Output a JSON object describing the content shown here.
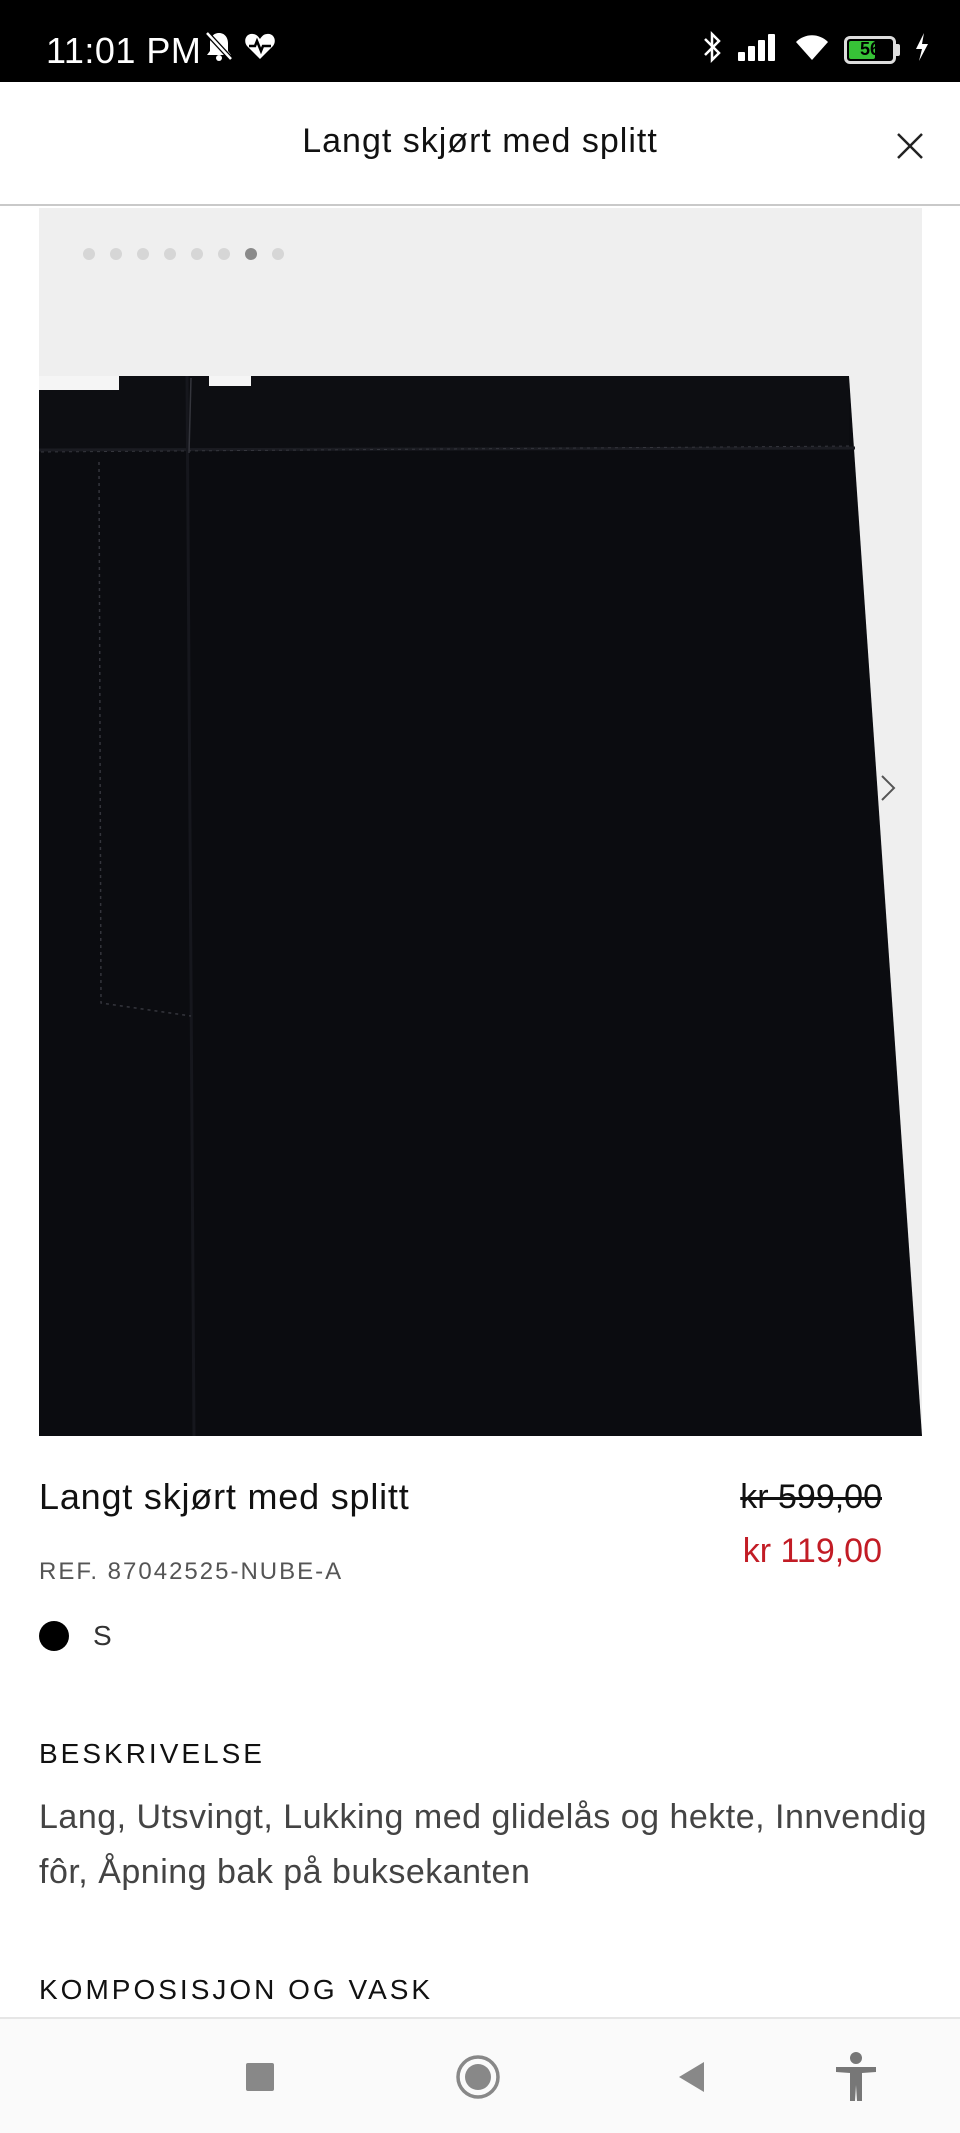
{
  "status_bar": {
    "time": "11:01 PM",
    "battery_level": "56",
    "icons": [
      "notifications-muted-icon",
      "health-heart-icon",
      "bluetooth-icon",
      "signal-icon",
      "wifi-icon",
      "battery-icon",
      "charging-icon"
    ]
  },
  "header": {
    "title": "Langt skjørt med splitt",
    "close_icon": "close-icon"
  },
  "gallery": {
    "dot_count": 8,
    "active_index": 6,
    "next_icon": "chevron-right-icon"
  },
  "product": {
    "name": "Langt skjørt med splitt",
    "price_original": "kr 599,00",
    "price_sale": "kr 119,00",
    "reference": "REF. 87042525-NUBE-A",
    "size": "S"
  },
  "description": {
    "title": "BESKRIVELSE",
    "text": "Lang, Utsvingt, Lukking med glidelås og hekte, Innvendig fôr, Åpning bak på buksekanten"
  },
  "composition": {
    "title": "KOMPOSISJON OG VASK"
  },
  "colors": {
    "sale_price": "#c21c25",
    "product_fabric": "#0b0c10",
    "battery_green": "#37c337"
  },
  "nav_bar": {
    "icons": [
      "recent-apps-icon",
      "home-icon",
      "back-icon",
      "accessibility-icon"
    ]
  }
}
